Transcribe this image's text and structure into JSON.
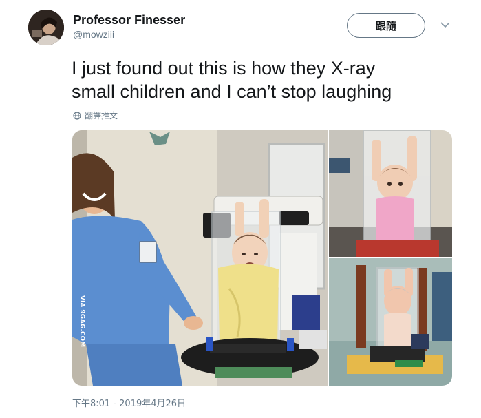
{
  "author": {
    "display_name": "Professor Finesser",
    "handle": "@mowziii"
  },
  "follow_button": {
    "label": "跟隨"
  },
  "tweet": {
    "text_line1": "I just found out this is how they X-ray",
    "text_line2": "small children and I can’t stop laughing",
    "translate_label": "翻譯推文",
    "timestamp": "下午8:01 - 2019年4月26日"
  },
  "media": {
    "watermark": "VIA 9GAG.COM",
    "images": [
      {
        "description_icon": "photo-nurse-with-baby-in-xray-tube"
      },
      {
        "description_icon": "photo-baby-pink-shirt-in-tube"
      },
      {
        "description_icon": "photo-baby-in-tube-on-stand"
      }
    ]
  },
  "colors": {
    "text_primary": "#14171a",
    "text_secondary": "#657786",
    "border": "#657786"
  },
  "icons": {
    "caret": "chevron-down-icon",
    "translate": "globe-icon"
  }
}
